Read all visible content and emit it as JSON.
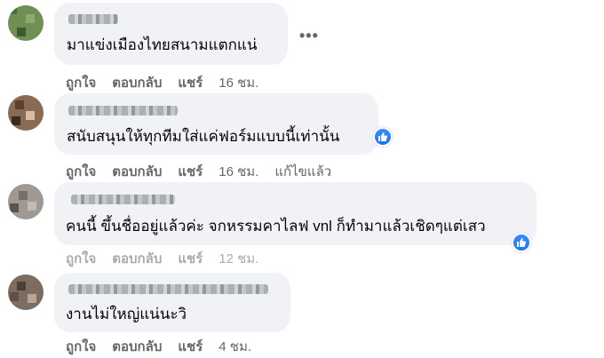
{
  "comments": [
    {
      "text": "มาแข่งเมืองไทยสนามแตกแน่",
      "actions": {
        "like": "ถูกใจ",
        "reply": "ตอบกลับ",
        "share": "แชร์",
        "time": "16 ชม.",
        "edited": ""
      },
      "more_icon": "•••",
      "has_like_badge": false
    },
    {
      "text": "สนับสนุนให้ทุกทีมใส่แค่ฟอร์มแบบนี้เท่านั้น",
      "actions": {
        "like": "ถูกใจ",
        "reply": "ตอบกลับ",
        "share": "แชร์",
        "time": "16 ชม.",
        "edited": "แก้ไขแล้ว"
      },
      "has_like_badge": true
    },
    {
      "text": "คนนี้ ขึ้นชื่ออยู่แล้วค่ะ จกหรรมคาไลฟ vnl ก็ทำมาแล้วเชิดๆแต่เสว",
      "actions": {
        "like": "ถูกใจ",
        "reply": "ตอบกลับ",
        "share": "แชร์",
        "time": "12 ชม.",
        "edited": ""
      },
      "has_like_badge": true
    },
    {
      "text": "งานไม่ใหญ่แน่นะวิ",
      "actions": {
        "like": "ถูกใจ",
        "reply": "ตอบกลับ",
        "share": "แชร์",
        "time": "4 ชม.",
        "edited": ""
      },
      "has_like_badge": false
    }
  ],
  "colors": {
    "bubble": "#f0f2f5",
    "meta": "#65676b",
    "like_blue": "#1877f2"
  },
  "icons": {
    "like_badge": "thumbs-up-icon",
    "more": "more-options-icon"
  }
}
